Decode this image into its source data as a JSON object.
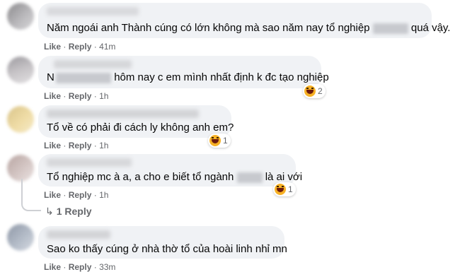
{
  "actions": {
    "like": "Like",
    "reply": "Reply",
    "sep": "·"
  },
  "comments": [
    {
      "text_before": "Năm ngoái anh Thành cúng có lớn không mà sao năm nay tổ nghiệp",
      "text_after": "quá vậy.",
      "time": "41m"
    },
    {
      "text_before": "N",
      "text_after": "hôm nay c em mình nhất định k đc tạo nghiệp",
      "time": "1h",
      "reaction_icon": "haha-icon",
      "reaction_count": "2"
    },
    {
      "text": "Tổ về có phải đi cách ly không anh em?",
      "time": "1h",
      "reaction_icon": "haha-icon",
      "reaction_count": "1"
    },
    {
      "text_before": "Tổ nghiệp mc à a, a cho e biết tổ ngành",
      "text_after": "là ai với",
      "time": "1h",
      "reaction_icon": "haha-icon",
      "reaction_count": "1",
      "replies_label": "1 Reply"
    },
    {
      "text": "Sao ko thấy cúng ở nhà thờ tổ của hoài linh nhỉ mn",
      "time": "33m"
    }
  ],
  "colors": {
    "bubble": "#f0f2f5",
    "meta": "#65676b",
    "text": "#050505",
    "haha": "#f7b125"
  }
}
